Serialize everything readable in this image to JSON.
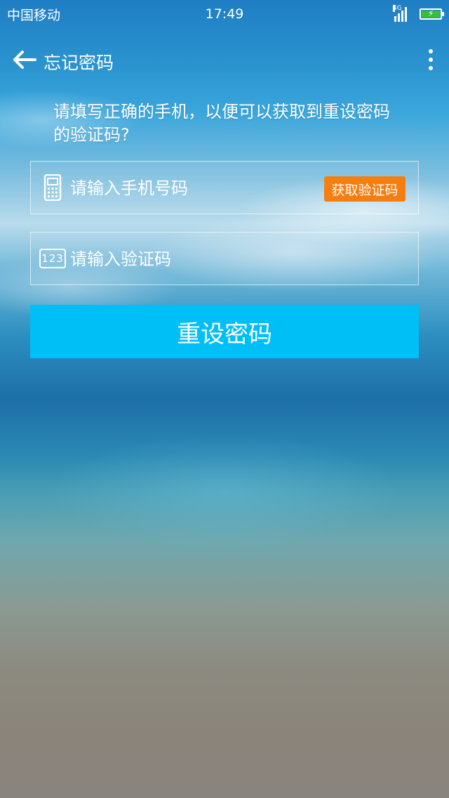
{
  "status_bar": {
    "carrier": "中国移动",
    "time": "17:49",
    "network": "4G"
  },
  "header": {
    "back_icon": "arrow-left-icon",
    "title": "忘记密码",
    "more_icon": "more-vertical-icon"
  },
  "instruction": "请填写正确的手机，以便可以获取到重设密码的验证码?",
  "form": {
    "phone_placeholder": "请输入手机号码",
    "phone_icon": "phone-icon",
    "get_code_label": "获取验证码",
    "code_placeholder": "请输入验证码",
    "code_icon_text": "123",
    "submit_label": "重设密码"
  },
  "colors": {
    "accent": "#00bef6",
    "get_code": "#f57e10",
    "battery": "#35c232"
  }
}
